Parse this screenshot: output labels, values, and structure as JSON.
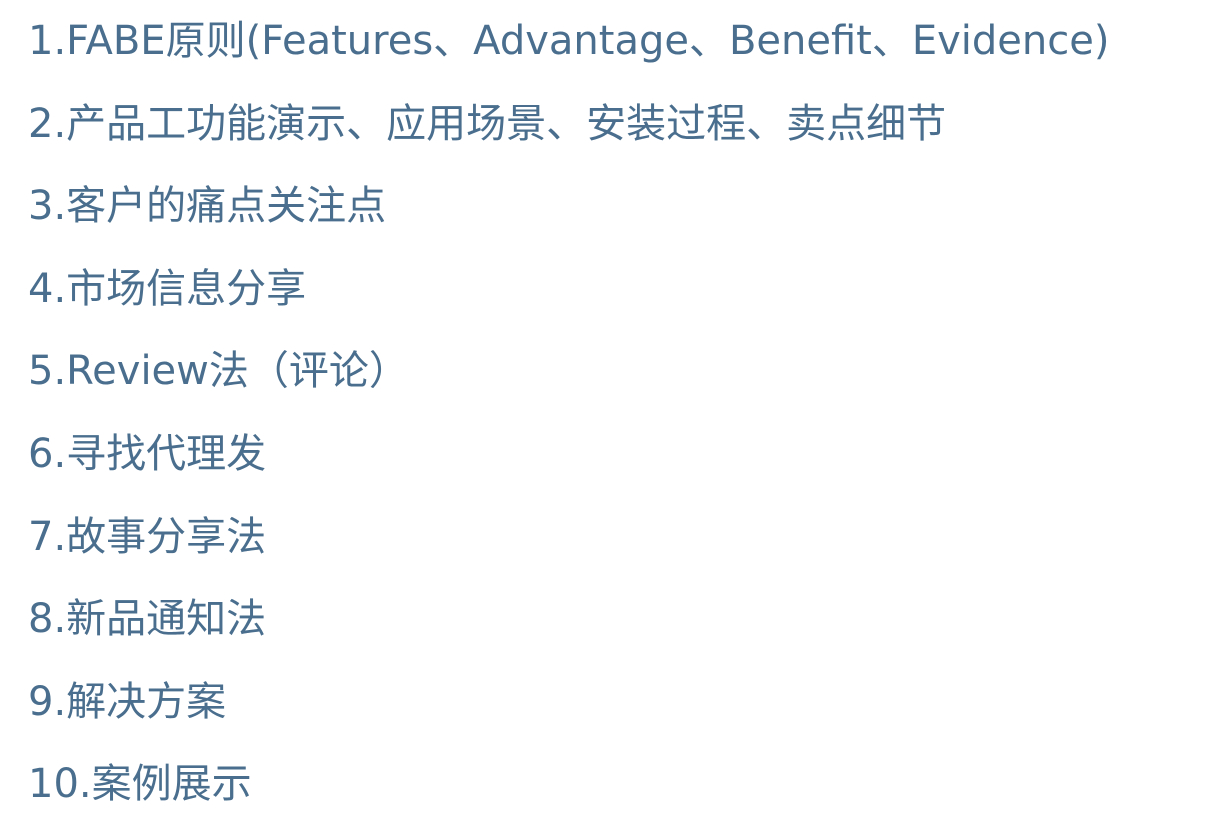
{
  "items": [
    "1.FABE原则(Features、Advantage、Benefit、Evidence)",
    "2.产品工功能演示、应用场景、安装过程、卖点细节",
    "3.客户的痛点关注点",
    "4.市场信息分享",
    "5.Review法（评论）",
    "6.寻找代理发",
    "7.故事分享法",
    "8.新品通知法",
    "9.解决方案",
    "10.案例展示"
  ],
  "colors": {
    "text": "#4a6f8e",
    "background": "#ffffff"
  }
}
